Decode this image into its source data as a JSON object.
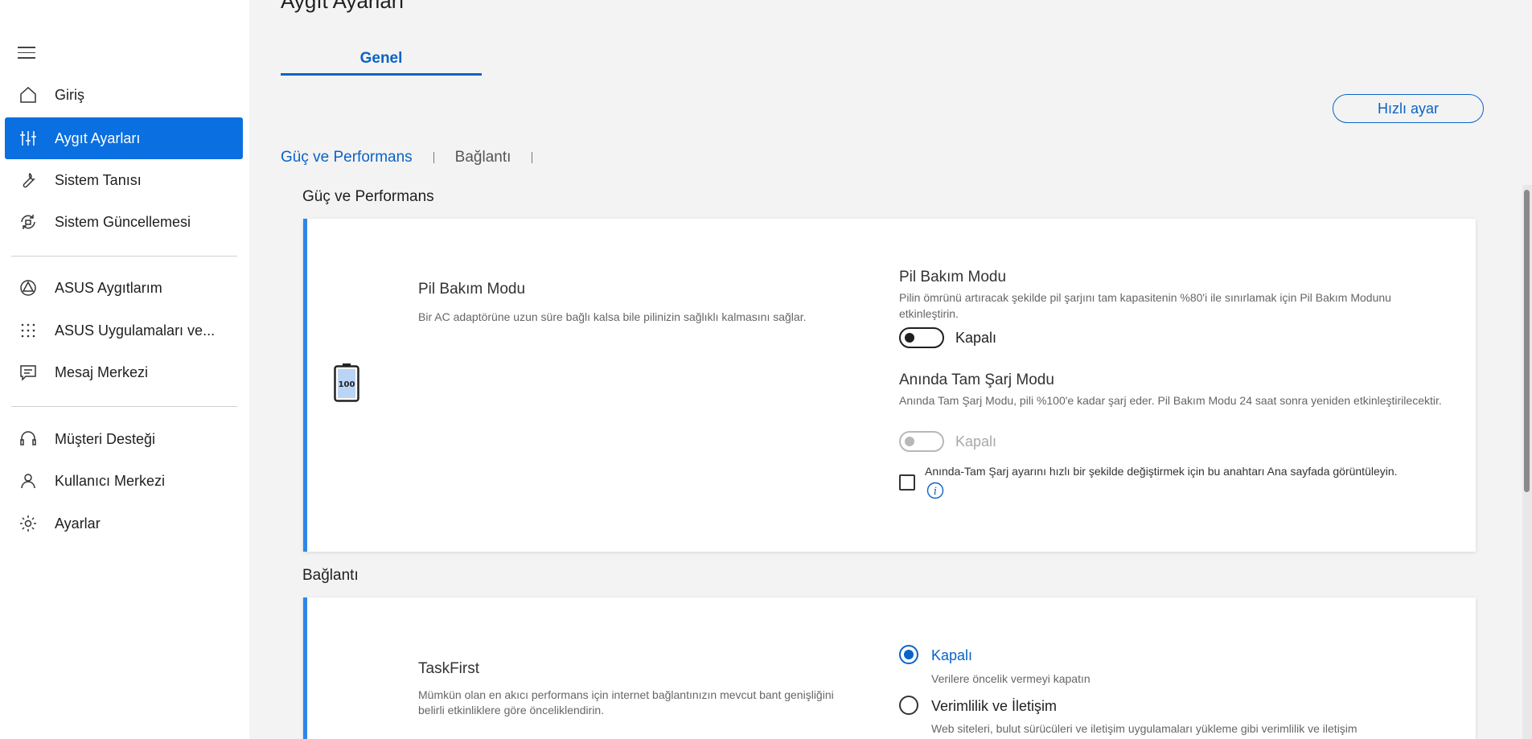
{
  "sidebar": {
    "items": [
      {
        "label": "Giriş",
        "icon": "home-icon"
      },
      {
        "label": "Aygıt Ayarları",
        "icon": "sliders-icon"
      },
      {
        "label": "Sistem Tanısı",
        "icon": "wrench-icon"
      },
      {
        "label": "Sistem Güncellemesi",
        "icon": "update-icon"
      },
      {
        "label": "ASUS Aygıtlarım",
        "icon": "asus-devices-icon"
      },
      {
        "label": "ASUS Uygulamaları ve...",
        "icon": "apps-grid-icon"
      },
      {
        "label": "Mesaj Merkezi",
        "icon": "message-icon"
      },
      {
        "label": "Müşteri Desteği",
        "icon": "headset-icon"
      },
      {
        "label": "Kullanıcı Merkezi",
        "icon": "user-icon"
      },
      {
        "label": "Ayarlar",
        "icon": "gear-icon"
      }
    ],
    "active_index": 1
  },
  "main": {
    "page_title": "Aygıt Ayarları",
    "tab": "Genel",
    "quick_button": "Hızlı ayar",
    "sub_tabs": [
      "Güç ve Performans",
      "Bağlantı"
    ],
    "section1": {
      "title": "Güç ve Performans",
      "feature_title": "Pil Bakım Modu",
      "feature_desc": "Bir AC adaptörüne uzun süre bağlı kalsa bile pilinizin sağlıklı kalmasını sağlar.",
      "battery_level": "100",
      "setting1": {
        "title": "Pil Bakım Modu",
        "desc": "Pilin ömrünü artıracak şekilde pil şarjını tam kapasitenin %80'i ile sınırlamak için Pil Bakım Modunu etkinleştirin.",
        "state": "Kapalı"
      },
      "setting2": {
        "title": "Anında Tam Şarj Modu",
        "desc": "Anında Tam Şarj Modu, pili %100'e kadar şarj eder. Pil Bakım Modu 24 saat sonra yeniden etkinleştirilecektir.",
        "state": "Kapalı"
      },
      "checkbox_label": "Anında-Tam Şarj ayarını hızlı bir şekilde değiştirmek için bu anahtarı Ana sayfada görüntüleyin."
    },
    "section2": {
      "title": "Bağlantı",
      "feature_title": "TaskFirst",
      "feature_desc": "Mümkün olan en akıcı performans için internet bağlantınızın mevcut bant genişliğini belirli etkinliklere göre önceliklendirin.",
      "options": [
        {
          "label": "Kapalı",
          "desc": "Verilere öncelik vermeyi kapatın"
        },
        {
          "label": "Verimlilik ve İletişim",
          "desc": "Web siteleri, bulut sürücüleri ve iletişim uygulamaları yükleme gibi verimlilik ve iletişim"
        }
      ],
      "selected_index": 0
    }
  },
  "colors": {
    "accent": "#0a63c7",
    "active_nav": "#0a6fe0",
    "card_border": "#2f86e8"
  }
}
